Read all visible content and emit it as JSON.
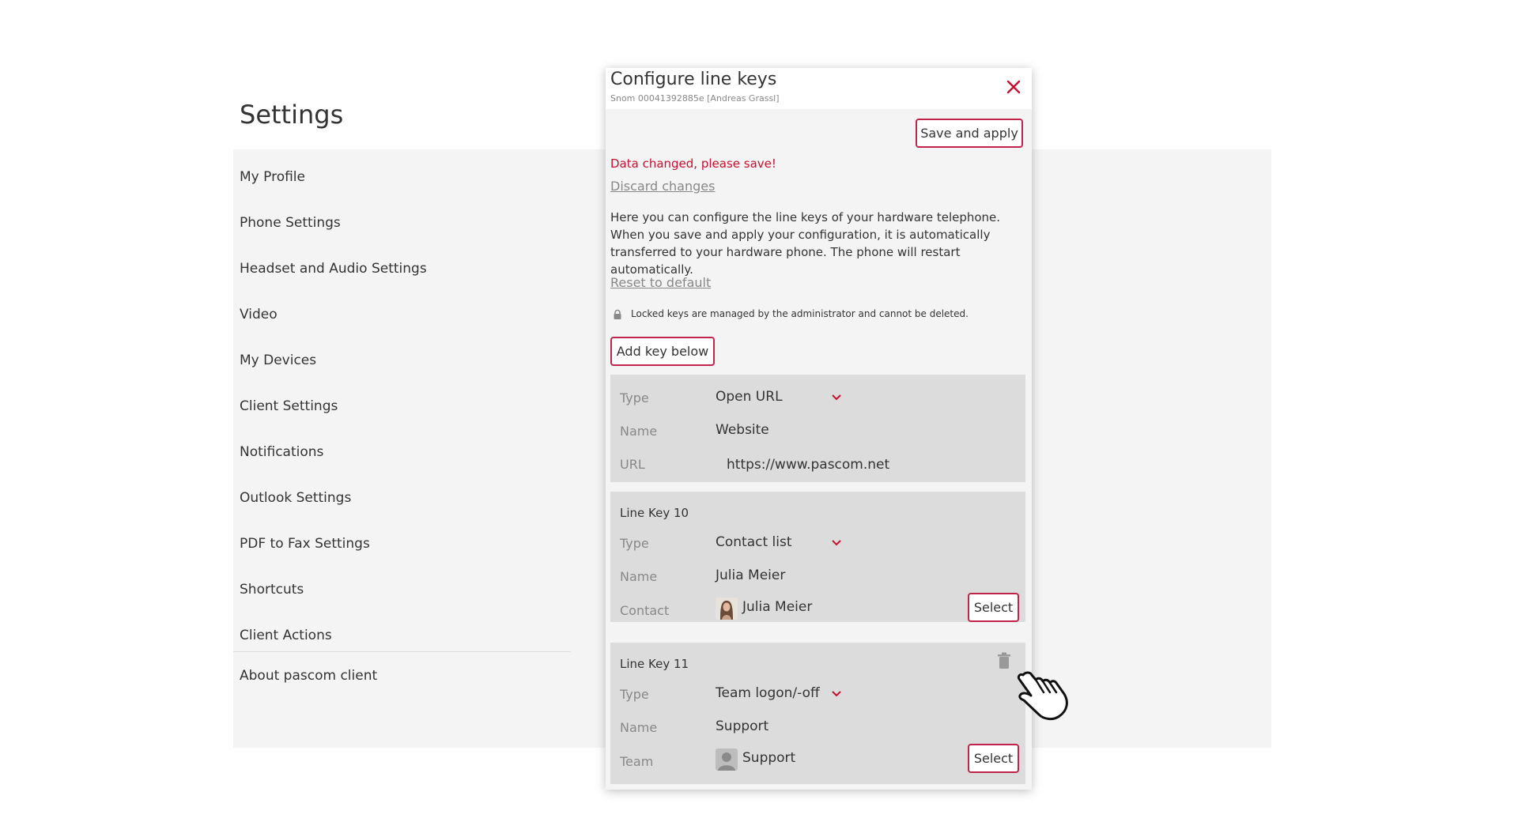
{
  "settings": {
    "title": "Settings",
    "nav": [
      "My Profile",
      "Phone Settings",
      "Headset and Audio Settings",
      "Video",
      "My Devices",
      "Client Settings",
      "Notifications",
      "Outlook Settings",
      "PDF to Fax Settings",
      "Shortcuts",
      "Client Actions"
    ],
    "about": "About pascom client"
  },
  "dialog": {
    "title": "Configure line keys",
    "subtitle": "Snom 00041392885e [Andreas Grassl]",
    "save_label": "Save and apply",
    "warning": "Data changed, please save!",
    "discard_label": "Discard changes",
    "help_text": "Here you can configure the line keys of your hardware telephone. When you save and apply your configuration, it is automatically transferred to your hardware phone. The phone will restart automatically.",
    "reset_label": "Reset to default",
    "lock_note": "Locked keys are managed by the administrator and cannot be deleted.",
    "add_label": "Add key below"
  },
  "keys": [
    {
      "type_label": "Type",
      "type_value": "Open URL",
      "name_label": "Name",
      "name_value": "Website",
      "url_label": "URL",
      "url_value": "https://www.pascom.net"
    },
    {
      "heading": "Line Key 10",
      "type_label": "Type",
      "type_value": "Contact list",
      "name_label": "Name",
      "name_value": "Julia Meier",
      "contact_label": "Contact",
      "contact_value": "Julia Meier",
      "select_label": "Select"
    },
    {
      "heading": "Line Key 11",
      "type_label": "Type",
      "type_value": "Team logon/-off",
      "name_label": "Name",
      "name_value": "Support",
      "team_label": "Team",
      "team_value": "Support",
      "select_label": "Select"
    }
  ],
  "colors": {
    "accent": "#c8102e",
    "panel_bg": "#f4f4f4",
    "card_bg": "#dcdcdc"
  },
  "icons": {
    "close": "close-icon",
    "chevron": "chevron-down-icon",
    "lock": "lock-icon",
    "trash": "trash-icon",
    "cursor": "hand-cursor-icon"
  }
}
